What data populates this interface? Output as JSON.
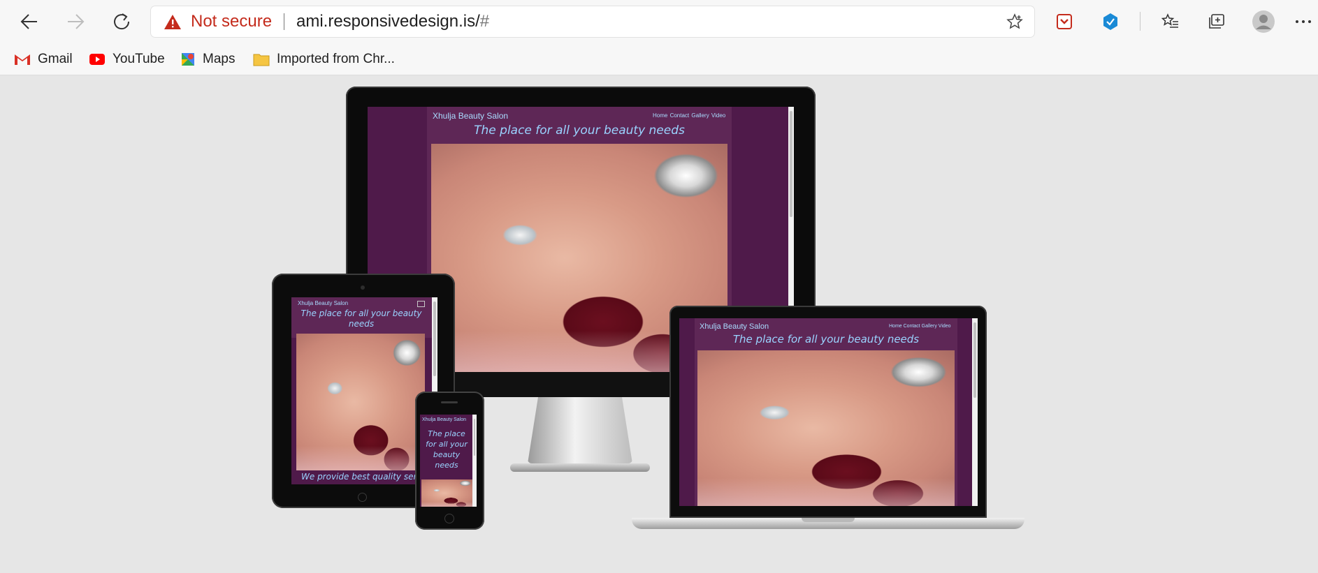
{
  "browser": {
    "security_label": "Not secure",
    "url_host": "ami.responsivedesign.is/",
    "url_hash": "#",
    "bookmarks": [
      {
        "label": "Gmail",
        "icon": "gmail-icon"
      },
      {
        "label": "YouTube",
        "icon": "youtube-icon"
      },
      {
        "label": "Maps",
        "icon": "maps-icon"
      },
      {
        "label": "Imported from Chr...",
        "icon": "folder-icon"
      }
    ]
  },
  "site": {
    "brand": "Xhulja Beauty Salon",
    "nav": "Home  Contact  Gallery  Video",
    "tagline": "The place for all your beauty needs",
    "subtitle": "We provide best quality servic"
  },
  "colors": {
    "site_background": "#4f1a4a",
    "site_header": "#5e2756",
    "site_text": "#a9dcff",
    "security_red": "#c42b1c"
  }
}
